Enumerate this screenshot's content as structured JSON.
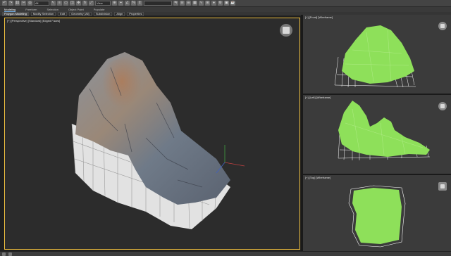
{
  "toolbar": {
    "icons": [
      "undo-icon",
      "redo-icon",
      "link-icon",
      "unlink-icon",
      "bind-icon",
      "selection-filter-icon",
      "select-icon",
      "select-by-name-icon",
      "rect-select-icon",
      "window-cross-icon",
      "move-icon",
      "rotate-icon",
      "scale-icon",
      "ref-coord-icon",
      "pivot-icon",
      "snap-icon",
      "angle-snap-icon",
      "percent-snap-icon",
      "spinner-snap-icon",
      "named-selection-icon",
      "mirror-icon",
      "align-icon",
      "layer-icon",
      "graphite-icon",
      "curve-editor-icon",
      "schematic-icon",
      "material-editor-icon",
      "render-setup-icon",
      "render-frame-icon",
      "render-icon"
    ],
    "filter_value": "All",
    "coord_value": "View"
  },
  "tabs": [
    {
      "label": "Modeling",
      "active": true
    },
    {
      "label": "Freeform",
      "active": false
    },
    {
      "label": "Selection",
      "active": false
    },
    {
      "label": "Object Paint",
      "active": false
    },
    {
      "label": "Populate",
      "active": false
    }
  ],
  "ribbon": {
    "items": [
      "Polygon Modeling",
      "Modify Selection",
      "Edit",
      "Geometry (All)",
      "Subdivision",
      "Align",
      "Properties"
    ]
  },
  "viewports": {
    "perspective": {
      "label": "[+] [Perspective] [Standard] [Edged Faces]"
    },
    "front": {
      "label": "[+] [Front] [Wireframe]"
    },
    "left": {
      "label": "[+] [Left] [Wireframe]"
    },
    "top": {
      "label": "[+] [Top] [Wireframe]"
    }
  },
  "colors": {
    "active_border": "#f0c040",
    "wire_fill": "#8ee05a",
    "mesh_light": "#e8e8e8",
    "rock_base": "#7d8590"
  }
}
